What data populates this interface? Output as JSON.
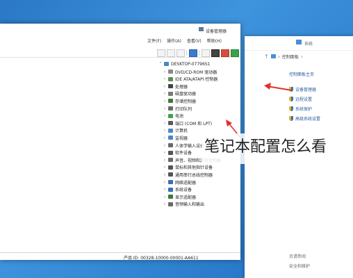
{
  "system_window": {
    "title": "系统",
    "breadcrumb": "控制面板",
    "home_link": "控制面板主页",
    "links": [
      {
        "label": "设备管理器",
        "icon": "shield-icon"
      },
      {
        "label": "远程设置",
        "icon": "shield-icon"
      },
      {
        "label": "系统保护",
        "icon": "shield-icon"
      },
      {
        "label": "高级系统设置",
        "icon": "shield-icon"
      }
    ],
    "see_also_label": "另请参阅",
    "security_link": "安全和维护"
  },
  "device_manager": {
    "title": "设备管理器",
    "menu": [
      "文件(F)",
      "操作(A)",
      "查看(V)",
      "帮助(H)"
    ],
    "root": "DESKTOP-07796S1",
    "devices": [
      {
        "label": "DVD/CD-ROM 驱动器",
        "icon": "disc-drive-icon",
        "color": "#8a8a8a"
      },
      {
        "label": "IDE ATA/ATAPI 控制器",
        "icon": "controller-icon",
        "color": "#5b8f4e"
      },
      {
        "label": "处理器",
        "icon": "processor-icon",
        "color": "#444444"
      },
      {
        "label": "磁盘驱动器",
        "icon": "disk-icon",
        "color": "#7a7a7a"
      },
      {
        "label": "存储控制器",
        "icon": "storage-icon",
        "color": "#3e7a3a"
      },
      {
        "label": "打印队列",
        "icon": "printer-icon",
        "color": "#6a6a6a"
      },
      {
        "label": "电池",
        "icon": "battery-icon",
        "color": "#3fa24a"
      },
      {
        "label": "端口 (COM 和 LPT)",
        "icon": "port-icon",
        "color": "#5a5a5a"
      },
      {
        "label": "计算机",
        "icon": "computer-icon",
        "color": "#4a88c7"
      },
      {
        "label": "监视器",
        "icon": "monitor-icon",
        "color": "#4a88c7"
      },
      {
        "label": "人体学输入设备",
        "icon": "hid-icon",
        "color": "#6b6b6b"
      },
      {
        "label": "软件设备",
        "icon": "software-device-icon",
        "color": "#555555"
      },
      {
        "label": "声音、视频和游戏控制器",
        "icon": "sound-icon",
        "color": "#6a6a6a"
      },
      {
        "label": "鼠标和其他指针设备",
        "icon": "mouse-icon",
        "color": "#555555"
      },
      {
        "label": "通用串行总线控制器",
        "icon": "usb-icon",
        "color": "#555555"
      },
      {
        "label": "网络适配器",
        "icon": "network-icon",
        "color": "#3a6fb3"
      },
      {
        "label": "系统设备",
        "icon": "system-device-icon",
        "color": "#3a6fb3"
      },
      {
        "label": "显示适配器",
        "icon": "display-adapter-icon",
        "color": "#3a7a3a"
      },
      {
        "label": "音频输入和输出",
        "icon": "audio-icon",
        "color": "#6a6a6a"
      }
    ],
    "status": "产品 ID: 00328-10000-00001-AA611"
  },
  "annotation": "笔记本配置怎么看",
  "colors": {
    "accent": "#2b5ca0",
    "arrow": "#e0302a",
    "desktop": "#2a78c6"
  }
}
